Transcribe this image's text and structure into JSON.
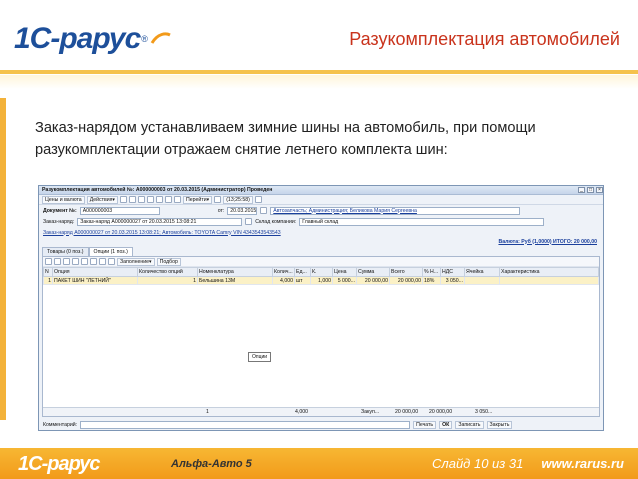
{
  "header": {
    "logo": "1С-рарус",
    "title": "Разукомплектация автомобилей"
  },
  "description": "Заказ-нарядом устанавливаем зимние шины на автомобиль, при помощи разукомплектации отражаем снятие летнего комплекта шин:",
  "window": {
    "title": "Разукомплектация автомобилей №: А000000003 от 20.03.2015 (Администратор) Проведен",
    "toolbar": {
      "prices": "Цены и валюта",
      "actions": "Действия",
      "goto": "Перейти",
      "time": "(13;25:58)"
    },
    "doc_label": "Документ №:",
    "doc_number": "А000000003",
    "from_label": "от:",
    "date": "20.03.2015",
    "info_link": "Автозапчасть; Администрация; Беликова Мария Сергеевна",
    "order_label": "Заказ-наряд:",
    "order_value": "Заказ-наряд А000000027 от 20.03.2015 13:08:21",
    "warehouse_label": "Склад компании:",
    "warehouse_value": "Главный склад",
    "order_info": "Заказ-наряд А000000027 от 20.03.2015 13:08:21; Автомобиль: TOYOTA Camry VIN 4343543543543",
    "currency": "Валюта: Руб (1,0000) ИТОГО: 20 000,00",
    "tabs": [
      "Товары (0 поз.)",
      "Опции (1 поз.)"
    ],
    "fill_label": "Заполнение",
    "select_label": "Подбор",
    "columns": [
      "N",
      "Опция",
      "Количество опций",
      "Номенклатура",
      "Колич...",
      "Ед...",
      "К.",
      "Цена",
      "Сумма",
      "Всего",
      "% Н...",
      "НДС",
      "Ячейка",
      "Характеристика"
    ],
    "rows": [
      [
        "1",
        "ПАКЕТ ШИН \"ЛЕТНИЙ\"",
        "1",
        "Бельшина 13М",
        "4,000",
        "шт",
        "1,000",
        "5 000...",
        "20 000,00",
        "20 000,00",
        "18%",
        "3 050...",
        "",
        ""
      ]
    ],
    "tooltip": "Опции",
    "totals": {
      "count": "1",
      "qty": "4,000",
      "label": "Закуп...",
      "sum": "20 000,00",
      "total": "20 000,00",
      "vat": "3 050..."
    },
    "comment_label": "Комментарий:",
    "buttons": [
      "Печать",
      "ОК",
      "Записать",
      "Закрыть"
    ]
  },
  "footer": {
    "logo": "1С-рарус",
    "product": "Альфа-Авто 5",
    "slide": "Слайд 10 из 31",
    "url": "www.rarus.ru"
  }
}
